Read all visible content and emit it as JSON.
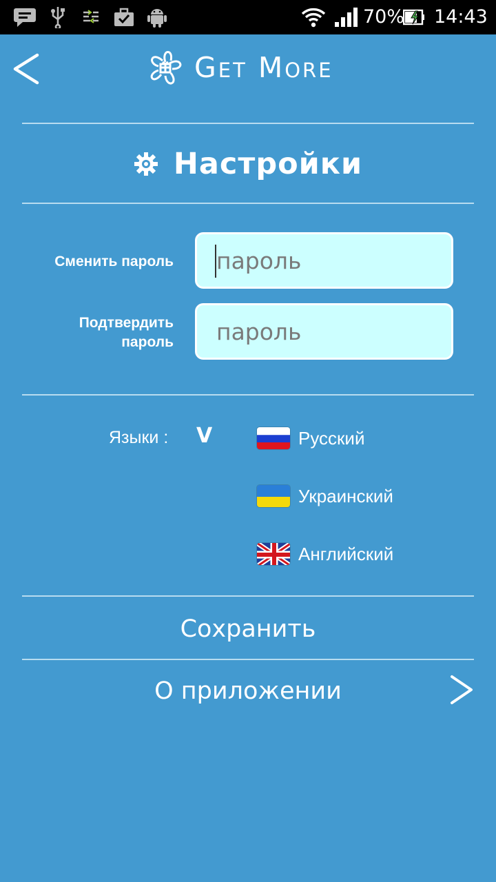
{
  "status_bar": {
    "icons": [
      "chat-icon",
      "usb-icon",
      "data-transfer-icon",
      "briefcase-check-icon",
      "android-icon",
      "wifi-icon",
      "signal-icon",
      "battery-charging-icon"
    ],
    "battery": "70%",
    "time": "14:43"
  },
  "header": {
    "app_name": "Get More"
  },
  "page": {
    "title": "Настройки"
  },
  "password": {
    "change_label": "Сменить пароль",
    "confirm_label_line1": "Подтвердить",
    "confirm_label_line2": "пароль",
    "placeholder": "пароль"
  },
  "languages": {
    "label": "Языки :",
    "selected_mark": "V",
    "items": [
      {
        "label": "Русский",
        "flag": "ru"
      },
      {
        "label": "Украинский",
        "flag": "ua"
      },
      {
        "label": "Английский",
        "flag": "gb"
      }
    ]
  },
  "actions": {
    "save": "Сохранить",
    "about": "О приложении"
  },
  "colors": {
    "background": "#439ad0",
    "input_bg": "#ccffff",
    "divider": "#b8dcf0"
  }
}
